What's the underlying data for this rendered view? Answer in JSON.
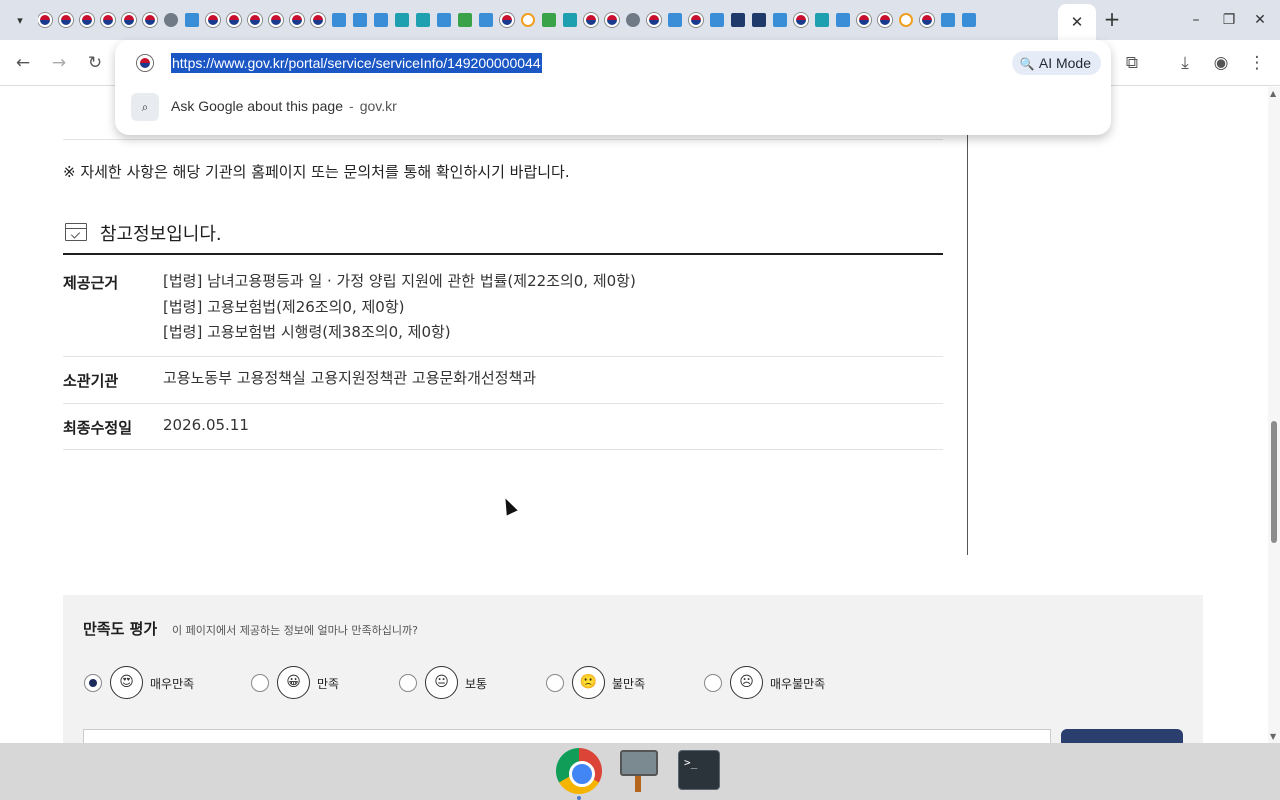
{
  "browser": {
    "tab_icons": [
      "gov",
      "gov",
      "gov",
      "gov",
      "gov",
      "gov",
      "globe",
      "blue",
      "gov",
      "gov",
      "gov",
      "gov",
      "gov",
      "gov",
      "blue",
      "blue",
      "blue",
      "teal",
      "teal",
      "blue",
      "green",
      "blue",
      "gov",
      "ring",
      "green",
      "teal",
      "gov",
      "gov",
      "globe",
      "gov",
      "blue",
      "gov",
      "blue",
      "navy",
      "navy",
      "blue",
      "gov",
      "teal",
      "blue",
      "gov",
      "gov",
      "ring",
      "gov",
      "blue",
      "blue"
    ],
    "active_tab_close": "✕",
    "new_tab": "+",
    "url": "https://www.gov.kr/portal/service/serviceInfo/149200000044",
    "ai_mode_label": "AI Mode",
    "suggestion": {
      "text": "Ask Google about this page",
      "separator": "-",
      "domain": "gov.kr"
    }
  },
  "page": {
    "notice": "※ 자세한 사항은 해당 기관의 홈페이지 또는 문의처를 통해 확인하시기 바랍니다.",
    "reference": {
      "title": "참고정보입니다.",
      "rows": [
        {
          "label": "제공근거",
          "values": [
            "[법령] 남녀고용평등과 일 · 가정 양립 지원에 관한 법률(제22조의0, 제0항)",
            "[법령] 고용보험법(제26조의0, 제0항)",
            "[법령] 고용보험법 시행령(제38조의0, 제0항)"
          ]
        },
        {
          "label": "소관기관",
          "values": [
            "고용노동부 고용정책실 고용지원정책관 고용문화개선정책과"
          ]
        },
        {
          "label": "최종수정일",
          "values": [
            "2026.05.11"
          ]
        }
      ]
    },
    "satisfaction": {
      "title": "만족도 평가",
      "subtitle": "이 페이지에서 제공하는 정보에 얼마나 만족하십니까?",
      "options": [
        {
          "label": "매우만족",
          "face": "😍",
          "selected": true
        },
        {
          "label": "만족",
          "face": "😀",
          "selected": false
        },
        {
          "label": "보통",
          "face": "😐",
          "selected": false
        },
        {
          "label": "불만족",
          "face": "🙁",
          "selected": false
        },
        {
          "label": "매우불만족",
          "face": "☹",
          "selected": false
        }
      ]
    }
  },
  "taskbar": {
    "terminal_label": ">_"
  }
}
